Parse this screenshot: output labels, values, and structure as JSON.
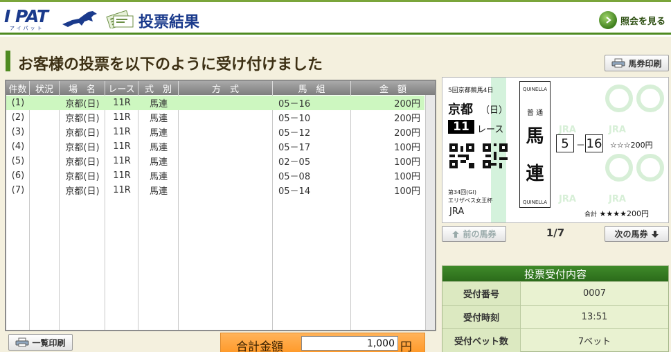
{
  "header": {
    "logo": "I PAT",
    "logo_sub": "アイパット",
    "title": "投票結果",
    "inquiry_button": "照会を見る"
  },
  "page": {
    "title": "お客様の投票を以下のように受け付けました",
    "print_ticket_button": "馬券印刷",
    "list_print_button": "一覧印刷"
  },
  "table": {
    "columns": [
      "件数",
      "状況",
      "場　名",
      "レース",
      "式　別",
      "方　式",
      "馬　組",
      "金　額"
    ],
    "rows": [
      {
        "no": "(1)",
        "status": "",
        "venue": "京都(日)",
        "race": "11R",
        "type": "馬連",
        "method": "",
        "combo": "05－16",
        "amount": "200円"
      },
      {
        "no": "(2)",
        "status": "",
        "venue": "京都(日)",
        "race": "11R",
        "type": "馬連",
        "method": "",
        "combo": "05－10",
        "amount": "200円"
      },
      {
        "no": "(3)",
        "status": "",
        "venue": "京都(日)",
        "race": "11R",
        "type": "馬連",
        "method": "",
        "combo": "05－12",
        "amount": "200円"
      },
      {
        "no": "(4)",
        "status": "",
        "venue": "京都(日)",
        "race": "11R",
        "type": "馬連",
        "method": "",
        "combo": "05－17",
        "amount": "100円"
      },
      {
        "no": "(5)",
        "status": "",
        "venue": "京都(日)",
        "race": "11R",
        "type": "馬連",
        "method": "",
        "combo": "02－05",
        "amount": "100円"
      },
      {
        "no": "(6)",
        "status": "",
        "venue": "京都(日)",
        "race": "11R",
        "type": "馬連",
        "method": "",
        "combo": "05－08",
        "amount": "100円"
      },
      {
        "no": "(7)",
        "status": "",
        "venue": "京都(日)",
        "race": "11R",
        "type": "馬連",
        "method": "",
        "combo": "05－14",
        "amount": "100円"
      }
    ]
  },
  "total": {
    "label": "合計金額",
    "value": "1,000",
    "unit": "円"
  },
  "ticket": {
    "meeting": "5回京都競馬4日",
    "venue": "京都",
    "day": "（日）",
    "race_number": "11",
    "race_label": "レース",
    "race_title_1": "第34回(GI)",
    "race_title_2": "エリザベス女王杯",
    "jra": "JRA",
    "quinella_en": "QUINELLA",
    "mode": "普 通",
    "type_char_1": "馬",
    "type_char_2": "連",
    "horse_1": "5",
    "dash": "－",
    "horse_2": "16",
    "line_amount": "☆☆☆200円",
    "total_label": "合計",
    "total_value": "★★★★200円",
    "watermark": "JRA"
  },
  "nav": {
    "prev": "前の馬券",
    "pager": "1/7",
    "next": "次の馬券"
  },
  "acceptance": {
    "title": "投票受付内容",
    "rows": [
      {
        "label": "受付番号",
        "value": "0007"
      },
      {
        "label": "受付時刻",
        "value": "13:51"
      },
      {
        "label": "受付ベット数",
        "value": "7ベット"
      }
    ]
  },
  "colors": {
    "brand_green": "#4e8a20",
    "brand_blue": "#1a3a8c",
    "selected_row": "#cdf7c0",
    "total_orange": "#ff9a2a"
  }
}
